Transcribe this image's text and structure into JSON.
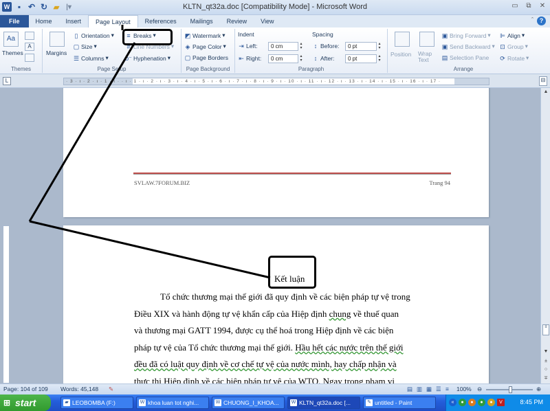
{
  "window": {
    "title": "KLTN_qt32a.doc [Compatibility Mode]  -  Microsoft Word"
  },
  "tabs": [
    "File",
    "Home",
    "Insert",
    "Page Layout",
    "References",
    "Mailings",
    "Review",
    "View"
  ],
  "ribbon": {
    "themes": {
      "themes_label": "Themes",
      "group": "Themes"
    },
    "page_setup": {
      "margins": "Margins",
      "orientation": "Orientation",
      "size": "Size",
      "columns": "Columns",
      "breaks": "Breaks",
      "line_numbers": "Line Numbers",
      "hyphenation": "Hyphenation",
      "group": "Page Setup"
    },
    "page_background": {
      "watermark": "Watermark",
      "page_color": "Page Color",
      "page_borders": "Page Borders",
      "group": "Page Background"
    },
    "paragraph": {
      "indent": "Indent",
      "left_label": "Left:",
      "left_value": "0 cm",
      "right_label": "Right:",
      "right_value": "0 cm",
      "spacing": "Spacing",
      "before_label": "Before:",
      "before_value": "0 pt",
      "after_label": "After:",
      "after_value": "0 pt",
      "group": "Paragraph"
    },
    "arrange": {
      "position": "Position",
      "wrap_text": "Wrap Text",
      "bring_forward": "Bring Forward",
      "send_backward": "Send Backward",
      "selection_pane": "Selection Pane",
      "align": "Align",
      "group_btn": "Group",
      "rotate": "Rotate",
      "group": "Arrange"
    }
  },
  "ruler": {
    "text": "· 3 · ı · 2 · ı · 1 · ı ·  · ı · 1 · ı · 2 · ı · 3 · ı · 4 · ı · 5 · ı · 6 · ı · 7 · ı · 8 · ı · 9 · ı · 10 · ı · 11 · ı · 12 · ı · 13 · ı · 14 · ı · 15 · ı · 16 · ı · 17 ·"
  },
  "document": {
    "footer_left": "SVLAW.7FORUM.BIZ",
    "footer_right": "Trang 94",
    "heading": "Kết luận",
    "para_1": "Tổ chức thương mại thế giới đã quy định về các biện pháp tự vệ trong",
    "para_2": "Điều XIX và hành động tự vệ khẩn cấp của Hiệp định",
    "para_2_ul": "chung",
    "para_2b": "về thuế quan",
    "para_3": "và thương mại GATT 1994, được cụ thể hoá trong Hiệp định về các biện",
    "para_4a": "pháp tự vệ của Tổ chức thương mại thế giới.",
    "para_4_ul": "Hầu hết các nước trên thế giới",
    "para_5_ul": "đều đã có luật quy định về cơ chế tự vệ của nước mình, hay chấp nhận và",
    "para_6": "thực thi Hiệp định về các biện pháp tự vệ của WTO. Ngay trong phạm vi"
  },
  "statusbar": {
    "page": "Page: 104 of 109",
    "words": "Words: 45,148",
    "zoom": "100%"
  },
  "taskbar": {
    "start": "start",
    "items": [
      "LEOBOMBA (F:)",
      "khoa luan tot nghi...",
      "CHUONG_I_KHOA...",
      "KLTN_qt32a.doc [...",
      "untitled - Paint"
    ],
    "clock": "8:45 PM"
  }
}
